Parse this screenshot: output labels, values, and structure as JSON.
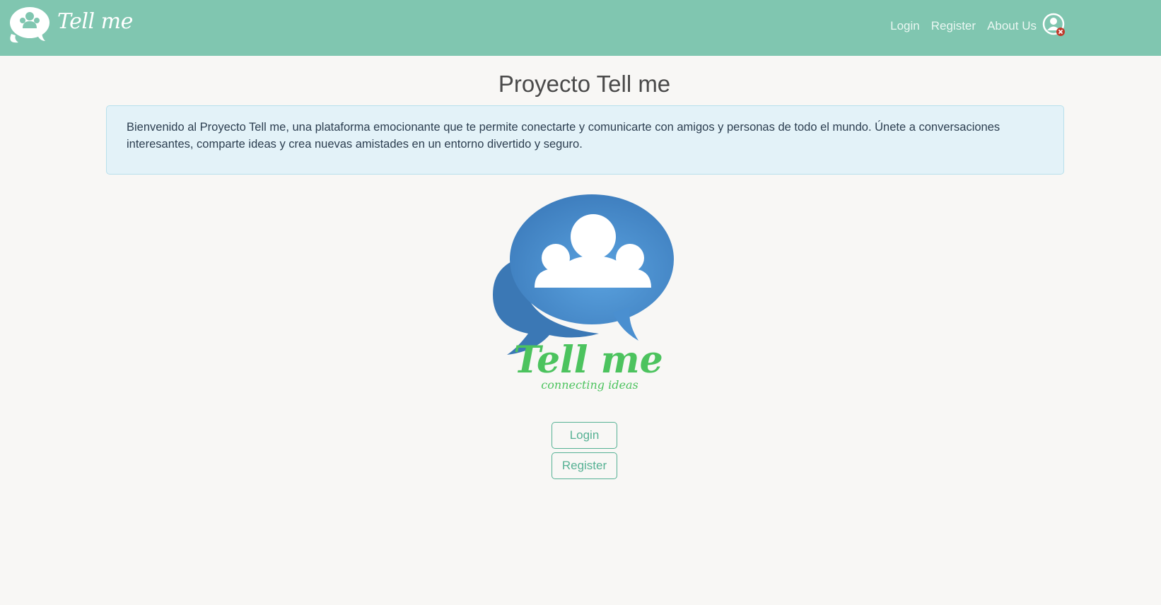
{
  "navbar": {
    "brand_name": "Tell me",
    "links": [
      {
        "label": "Login"
      },
      {
        "label": "Register"
      },
      {
        "label": "About Us"
      }
    ],
    "user_icon": "user-disconnected-icon"
  },
  "main": {
    "title": "Proyecto Tell me",
    "info_text": "Bienvenido al Proyecto Tell me, una plataforma emocionante que te permite conectarte y comunicarte con amigos y personas de todo el mundo. Únete a conversaciones interesantes, comparte ideas y crea nuevas amistades en un entorno divertido y seguro.",
    "logo_text": "Tell me",
    "logo_tagline": "connecting ideas",
    "buttons": {
      "login": "Login",
      "register": "Register"
    }
  },
  "colors": {
    "navbar": "#80c6b0",
    "background": "#f8f7f5",
    "accent": "#56b194",
    "logo_blue": "#4a8fd0",
    "logo_green": "#4cc35e"
  }
}
